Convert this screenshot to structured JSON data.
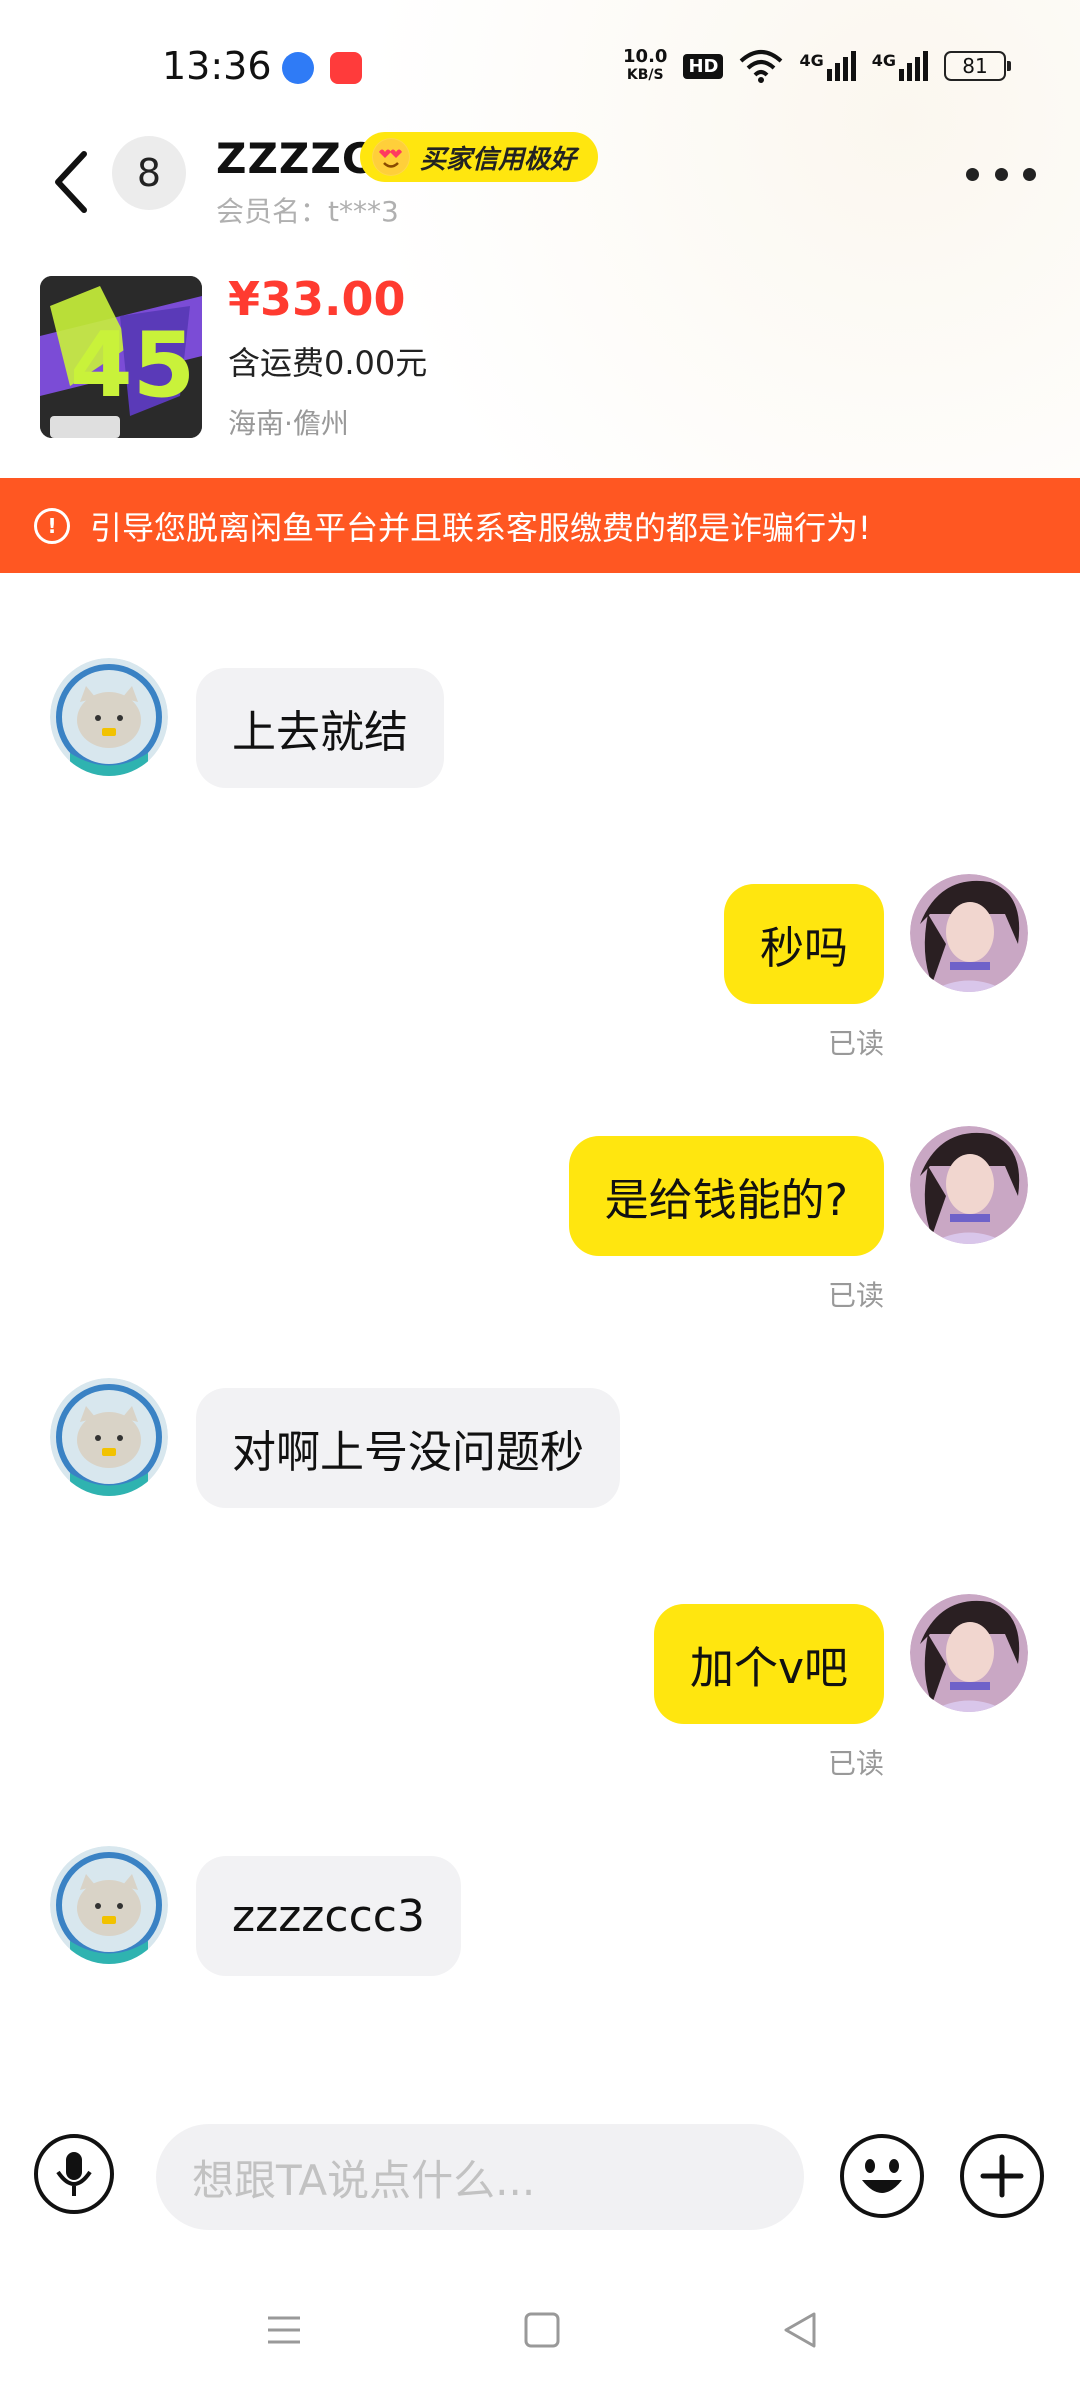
{
  "status_bar": {
    "time": "13:36",
    "net_speed_value": "10.0",
    "net_speed_unit": "KB/S",
    "hd_label": "HD",
    "signal_1": "4G",
    "signal_2": "4G",
    "battery": "81"
  },
  "header": {
    "unread_count": "8",
    "contact_name": "ZZZZC",
    "credit_badge": "买家信用极好",
    "member_label": "会员名：t***3"
  },
  "product": {
    "price": "¥33.00",
    "shipping": "含运费0.00元",
    "location": "海南·儋州",
    "thumb_text": "45"
  },
  "warning": {
    "text": "引导您脱离闲鱼平台并且联系客服缴费的都是诈骗行为!"
  },
  "messages": [
    {
      "side": "left",
      "text": "上去就结"
    },
    {
      "side": "right",
      "text": "秒吗",
      "status": "已读"
    },
    {
      "side": "right",
      "text": "是给钱能的?",
      "status": "已读"
    },
    {
      "side": "left",
      "text": "对啊上号没问题秒"
    },
    {
      "side": "right",
      "text": "加个v吧",
      "status": "已读"
    },
    {
      "side": "left",
      "text": "zzzzccc3"
    }
  ],
  "input": {
    "placeholder": "想跟TA说点什么..."
  },
  "colors": {
    "accent_yellow": "#ffe60f",
    "warning_orange": "#ff5722",
    "price_red": "#ff3b30"
  },
  "icons": [
    "back-icon",
    "more-icon",
    "warning-icon",
    "microphone-icon",
    "emoji-icon",
    "plus-icon",
    "menu-icon",
    "home-icon",
    "back-triangle-icon"
  ]
}
